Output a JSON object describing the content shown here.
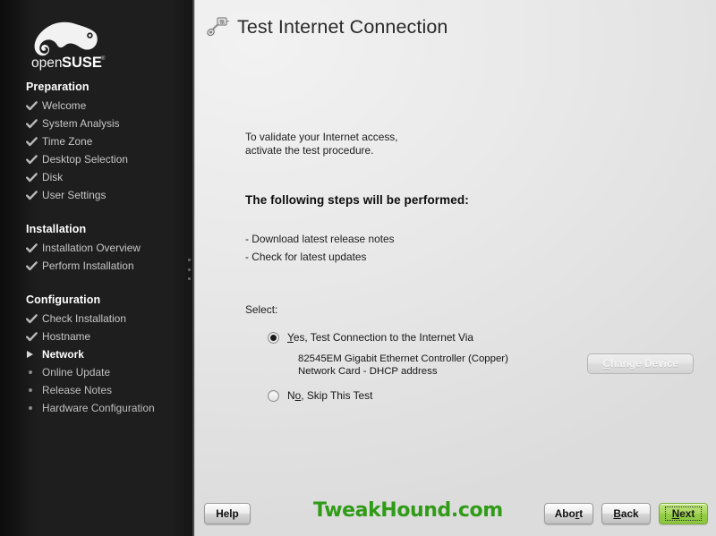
{
  "window": {
    "title": "Test Internet Connection"
  },
  "sidebar": {
    "logo_alt": "openSUSE",
    "logo_text_open": "open",
    "logo_text_suse": "SUSE",
    "sections": [
      {
        "heading": "Preparation",
        "items": [
          {
            "label": "Welcome",
            "state": "done"
          },
          {
            "label": "System Analysis",
            "state": "done"
          },
          {
            "label": "Time Zone",
            "state": "done"
          },
          {
            "label": "Desktop Selection",
            "state": "done"
          },
          {
            "label": "Disk",
            "state": "done"
          },
          {
            "label": "User Settings",
            "state": "done"
          }
        ]
      },
      {
        "heading": "Installation",
        "items": [
          {
            "label": "Installation Overview",
            "state": "done"
          },
          {
            "label": "Perform Installation",
            "state": "done"
          }
        ]
      },
      {
        "heading": "Configuration",
        "items": [
          {
            "label": "Check Installation",
            "state": "done"
          },
          {
            "label": "Hostname",
            "state": "done"
          },
          {
            "label": "Network",
            "state": "current"
          },
          {
            "label": "Online Update",
            "state": "pending"
          },
          {
            "label": "Release Notes",
            "state": "pending"
          },
          {
            "label": "Hardware Configuration",
            "state": "pending"
          }
        ]
      }
    ]
  },
  "header": {
    "icon": "network-plug-icon",
    "title": "Test Internet Connection"
  },
  "main": {
    "intro_line1": "To validate your Internet access,",
    "intro_line2": "activate the test procedure.",
    "steps_title": "The following steps will be performed:",
    "steps": [
      "- Download latest release notes",
      "- Check for latest updates"
    ],
    "select_label": "Select:",
    "options": [
      {
        "id": "yes",
        "mnemonic": "Y",
        "label_rest": "es, Test Connection to the Internet Via",
        "checked": true
      },
      {
        "id": "no",
        "mnemonic_pre": "N",
        "mnemonic": "o",
        "label_rest": ", Skip This Test",
        "checked": false
      }
    ],
    "device": {
      "line1": "82545EM Gigabit Ethernet Controller (Copper)",
      "line2": "Network Card - DHCP address",
      "change_button_mnemonic": "C",
      "change_button_rest": "hange Device"
    }
  },
  "footer": {
    "help_label": "Help",
    "watermark": "TweakHound.com",
    "abort_pre": "Abo",
    "abort_mnemonic": "r",
    "abort_post": "t",
    "back_mnemonic": "B",
    "back_rest": "ack",
    "next_mnemonic": "N",
    "next_rest": "ext"
  },
  "colors": {
    "sidebar_bg": "#1b1b1b",
    "main_bg": "#e6e6e6",
    "accent_green": "#8bc63f",
    "watermark_green": "#2f9b16",
    "text_dark": "#1c1c1c"
  }
}
